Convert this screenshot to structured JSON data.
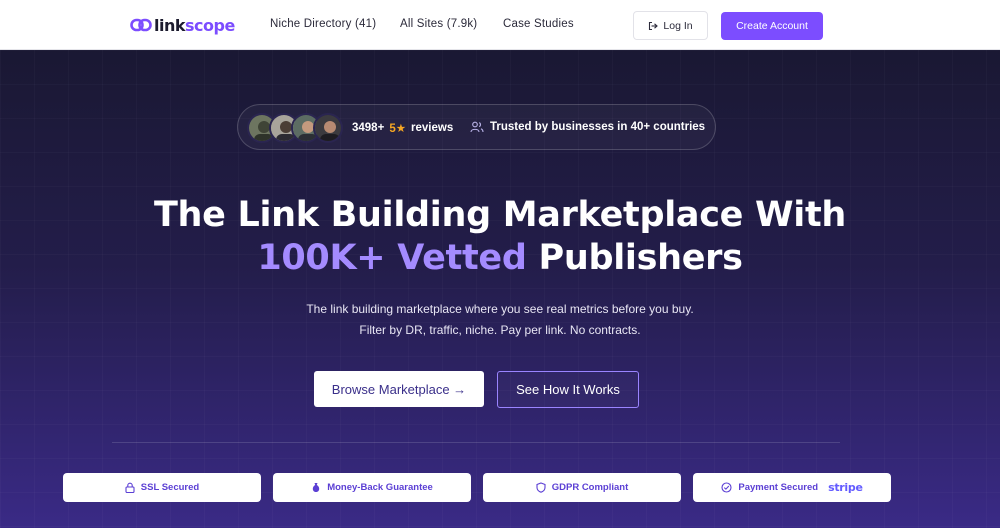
{
  "nav": {
    "logo_link": "link",
    "logo_scope": "scope",
    "links": [
      "Niche Directory (41)",
      "All Sites (7.9k)",
      "Case Studies"
    ],
    "login_label": "Log In",
    "create_label": "Create Account"
  },
  "reviews": {
    "count": "3498+",
    "rating": "5★",
    "label": "reviews",
    "trust": "Trusted by businesses in 40+ countries",
    "avatars": [
      "avatar-1",
      "avatar-2",
      "avatar-3",
      "avatar-4"
    ]
  },
  "hero": {
    "title_line1": "The Link Building Marketplace With",
    "title_highlight": "100K+ Vetted",
    "title_rest": "Publishers",
    "sub_line1": "The link building marketplace where you see real metrics before you buy.",
    "sub_line2": "Filter by DR, traffic, niche. Pay per link. No contracts."
  },
  "cta": {
    "browse": "Browse Marketplace →",
    "how": "See How It Works"
  },
  "badges": {
    "ssl": "SSL Secured",
    "money": "Money-Back Guarantee",
    "gdpr": "GDPR Compliant",
    "payment": "Payment Secured",
    "stripe": "stripe"
  },
  "colors": {
    "accent": "#7c4dff",
    "highlight": "#a48bff",
    "star": "#f5a623",
    "hero_bg": "#1e1a3c"
  },
  "icons": {
    "login": "login-icon",
    "trust": "users-icon",
    "ssl": "lock-icon",
    "money": "money-bag-icon",
    "gdpr": "shield-icon",
    "payment": "check-circle-icon"
  }
}
